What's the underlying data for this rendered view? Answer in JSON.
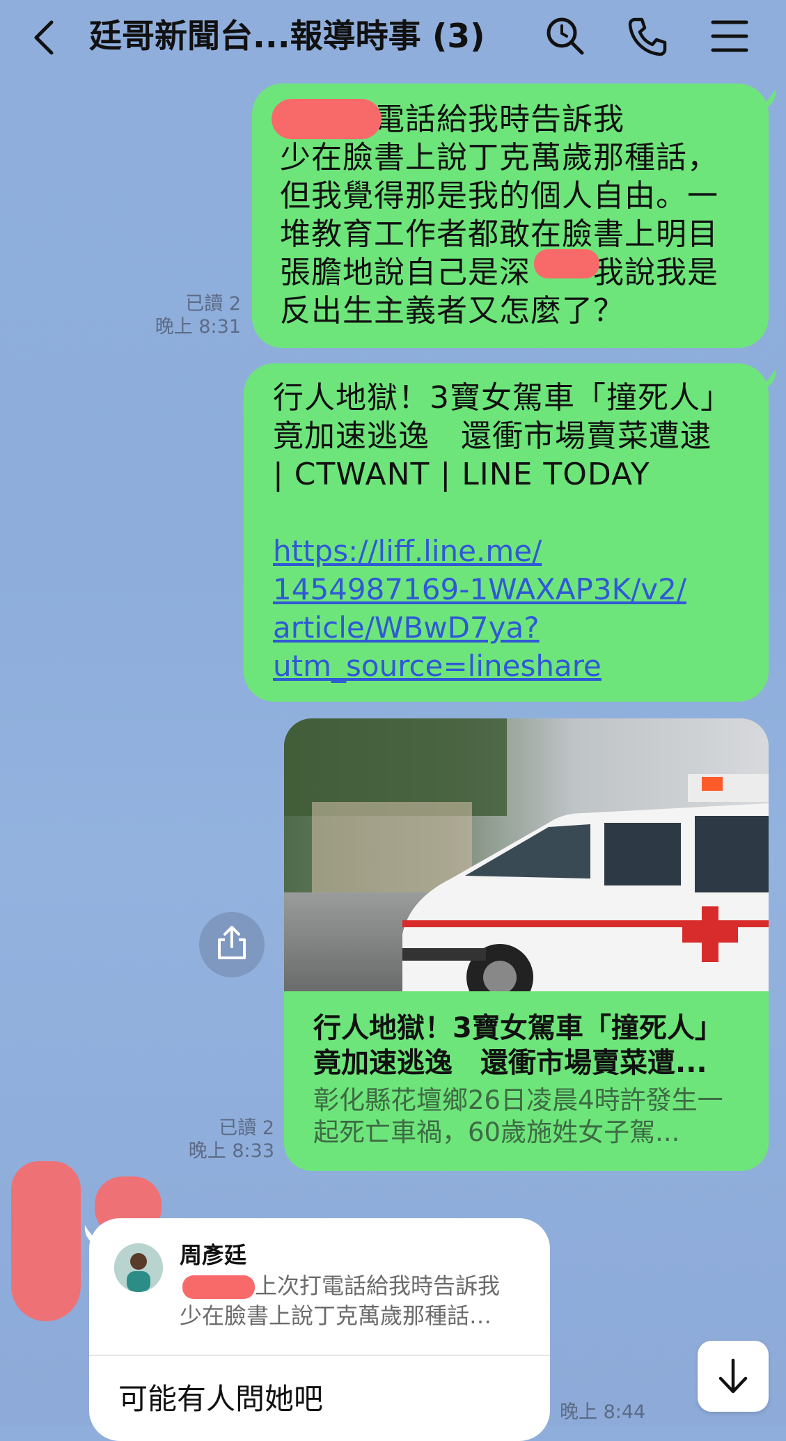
{
  "header": {
    "title": "廷哥新聞台...報導時事 (3)",
    "icons": [
      "back-icon",
      "search-icon",
      "phone-icon",
      "menu-icon"
    ]
  },
  "messages": [
    {
      "text": "上次打電話給我時告訴我\n少在臉書上說丁克萬歲那種話，\n但我覺得那是我的個人自由。一\n堆教育工作者都敢在臉書上明目\n張膽地說自己是深　　我說我是\n反出生主義者又怎麼了？",
      "read": "已讀 2",
      "time": "晚上 8:31"
    },
    {
      "text": "行人地獄！3寶女駕車「撞死人」\n竟加速逃逸　還衝市場賣菜遭逮\n| CTWANT | LINE TODAY",
      "link_lines": [
        "https://liff.line.me/",
        "1454987169-1WAXAP3K/v2/",
        "article/WBwD7ya?",
        "utm_source=lineshare"
      ]
    },
    {
      "card_title": "行人地獄！3寶女駕車「撞死人」竟加速逃逸　還衝市場賣菜遭...",
      "card_desc": "彰化縣花壇鄉26日凌晨4時許發生一起死亡車禍，60歲施姓女子駕...",
      "read": "已讀 2",
      "time": "晚上 8:33"
    }
  ],
  "reply": {
    "quoted_name": "周彥廷",
    "quoted_text_line1": "上次打電話給我時告訴我",
    "quoted_text_line2": "少在臉書上說丁克萬歲那種話…",
    "text": "可能有人問她吧",
    "time": "晚上 8:44"
  },
  "colors": {
    "bubble_green": "#6ee57a",
    "background": "#8faedb",
    "link": "#2f59d6",
    "redaction": "#f86a6a"
  }
}
